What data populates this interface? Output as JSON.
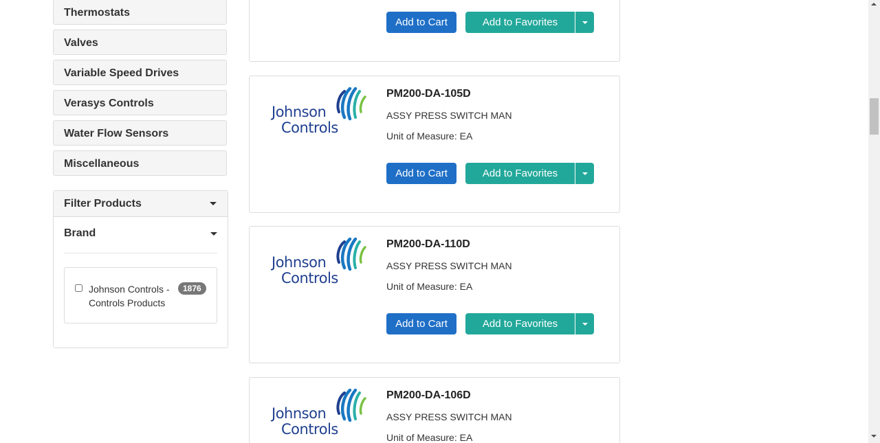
{
  "sidebar": {
    "categories": [
      {
        "label": "Thermostats"
      },
      {
        "label": "Valves"
      },
      {
        "label": "Variable Speed Drives"
      },
      {
        "label": "Verasys Controls"
      },
      {
        "label": "Water Flow Sensors"
      },
      {
        "label": "Miscellaneous"
      }
    ],
    "filter": {
      "title": "Filter Products",
      "brand_title": "Brand",
      "brands": [
        {
          "label": "Johnson Controls - Controls Products",
          "count": "1876",
          "checked": false
        }
      ]
    }
  },
  "logo": {
    "line1": "Johnson",
    "line2": "Controls",
    "colors": [
      "#1f3f8f",
      "#1a78c2",
      "#2ab0a6",
      "#7ac143"
    ]
  },
  "buttons": {
    "add_to_cart": "Add to Cart",
    "add_to_favorites": "Add to Favorites"
  },
  "products": [
    {
      "sku": "",
      "description": "",
      "uom": ""
    },
    {
      "sku": "PM200-DA-105D",
      "description": "ASSY PRESS SWITCH MAN",
      "uom": "Unit of Measure: EA"
    },
    {
      "sku": "PM200-DA-110D",
      "description": "ASSY PRESS SWITCH MAN",
      "uom": "Unit of Measure: EA"
    },
    {
      "sku": "PM200-DA-106D",
      "description": "ASSY PRESS SWITCH MAN",
      "uom": "Unit of Measure: EA"
    }
  ]
}
